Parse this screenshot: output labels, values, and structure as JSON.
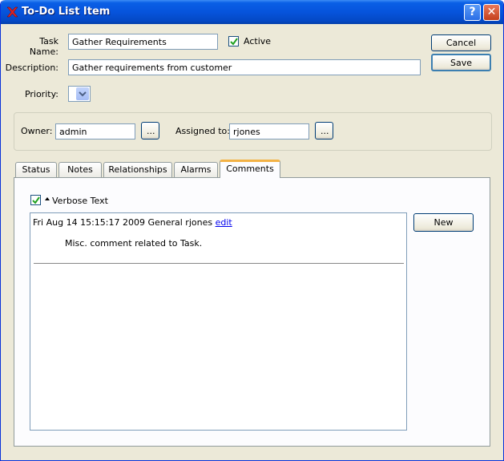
{
  "window": {
    "title": "To-Do List Item"
  },
  "form": {
    "task_name_label": "Task Name:",
    "task_name_value": "Gather Requirements",
    "active_label": "Active",
    "description_label": "Description:",
    "description_value": "Gather requirements from customer",
    "priority_label": "Priority:",
    "priority_value": ""
  },
  "actions": {
    "cancel_label": "Cancel",
    "save_label": "Save"
  },
  "ownership": {
    "owner_label": "Owner:",
    "owner_value": "admin",
    "owner_lookup_label": "...",
    "assigned_label": "Assigned to:",
    "assigned_value": "rjones",
    "assigned_lookup_label": "..."
  },
  "tabs": [
    {
      "label": "Status"
    },
    {
      "label": "Notes"
    },
    {
      "label": "Relationships"
    },
    {
      "label": "Alarms"
    },
    {
      "label": "Comments"
    }
  ],
  "comments": {
    "verbose_label": "Verbose Text",
    "new_label": "New",
    "entries": [
      {
        "header": "Fri Aug 14 15:15:17 2009 General rjones",
        "edit_label": "edit",
        "body": "Misc. comment related to Task."
      }
    ]
  }
}
